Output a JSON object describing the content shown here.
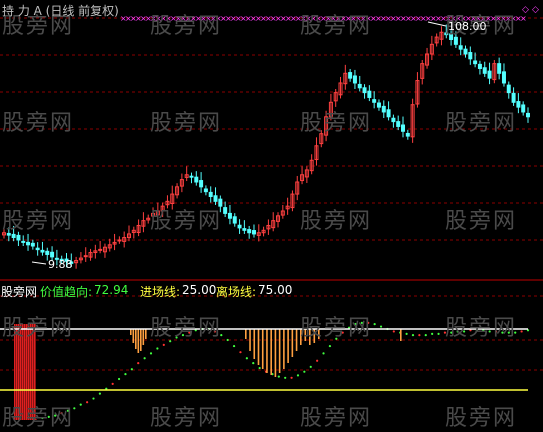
{
  "colors": {
    "up": "#ff4040",
    "down": "#54ffff",
    "grid": "#8b0000",
    "panel_border": "#c00000",
    "marker": "#ff40ff",
    "dot_up": "#ff3030",
    "dot_down": "#40ff40",
    "bar": "#ffa040",
    "red_bar": "#e02020",
    "white_line": "#ffffff",
    "yellow_line": "#ffff40",
    "value_green": "#40ff40",
    "text_white": "#ffffff",
    "text_yellow": "#ffff40",
    "watermark": "#4a4a4a",
    "top_title": "#c0c0c0"
  },
  "header": {
    "title": "持  力 A (日线 前复权)"
  },
  "price_panel": {
    "high_label": "108.00",
    "low_label": "9.88"
  },
  "indicator": {
    "name": "股旁网",
    "trend_label": "价值趋向:",
    "trend_value": "72.94",
    "entry_label": "进场线:",
    "entry_value": "25.00",
    "exit_label": "离场线:",
    "exit_value": "75.00"
  },
  "watermark": {
    "text": "股旁网"
  },
  "chart_data": {
    "type": "candlestick+indicator",
    "title": "",
    "price_range_labels": {
      "max": 108.0,
      "min": 9.88
    },
    "closes": [
      22,
      21,
      20,
      19,
      18,
      17,
      16.5,
      15,
      14,
      13,
      12,
      11,
      10.5,
      10.2,
      9.9,
      10.5,
      11.5,
      12.5,
      13.8,
      14.5,
      15,
      16,
      17,
      18,
      19,
      20,
      21.5,
      23,
      25,
      27,
      28,
      30,
      31,
      33,
      35,
      38,
      41,
      44,
      46,
      45,
      43,
      41,
      39,
      37,
      35,
      33,
      30,
      28,
      26,
      24,
      23,
      22,
      21.5,
      22,
      23,
      25,
      27,
      29,
      31,
      33,
      38,
      43,
      46,
      48,
      52,
      58,
      63,
      70,
      76,
      80,
      84,
      88,
      86,
      84,
      82,
      80,
      78,
      76,
      74,
      72,
      70,
      68,
      66,
      64,
      62,
      75,
      85,
      92,
      96,
      100,
      103,
      105,
      104,
      102,
      100,
      98,
      96,
      94,
      92,
      90,
      88,
      86,
      92,
      88,
      84,
      80,
      76,
      74,
      72,
      70
    ],
    "indicator_values": [
      0,
      2,
      3,
      4,
      6,
      8,
      10,
      13,
      15,
      18,
      22,
      26,
      30,
      34,
      38,
      42,
      47,
      51,
      55,
      59,
      62,
      65,
      68,
      70,
      72,
      74,
      75,
      75,
      73,
      70,
      66,
      61,
      56,
      51,
      47,
      43,
      40,
      38,
      36,
      35,
      35,
      37,
      40,
      44,
      49,
      55,
      61,
      67,
      72,
      76,
      79,
      80,
      80,
      79,
      77,
      75,
      73,
      72,
      71,
      70,
      70,
      70,
      71,
      71,
      72,
      72,
      73,
      73,
      74,
      74,
      74,
      73,
      73,
      72,
      72,
      72,
      73,
      74
    ],
    "entry_line": 25.0,
    "exit_line": 75.0,
    "ylim_indicator": [
      0,
      100
    ]
  }
}
